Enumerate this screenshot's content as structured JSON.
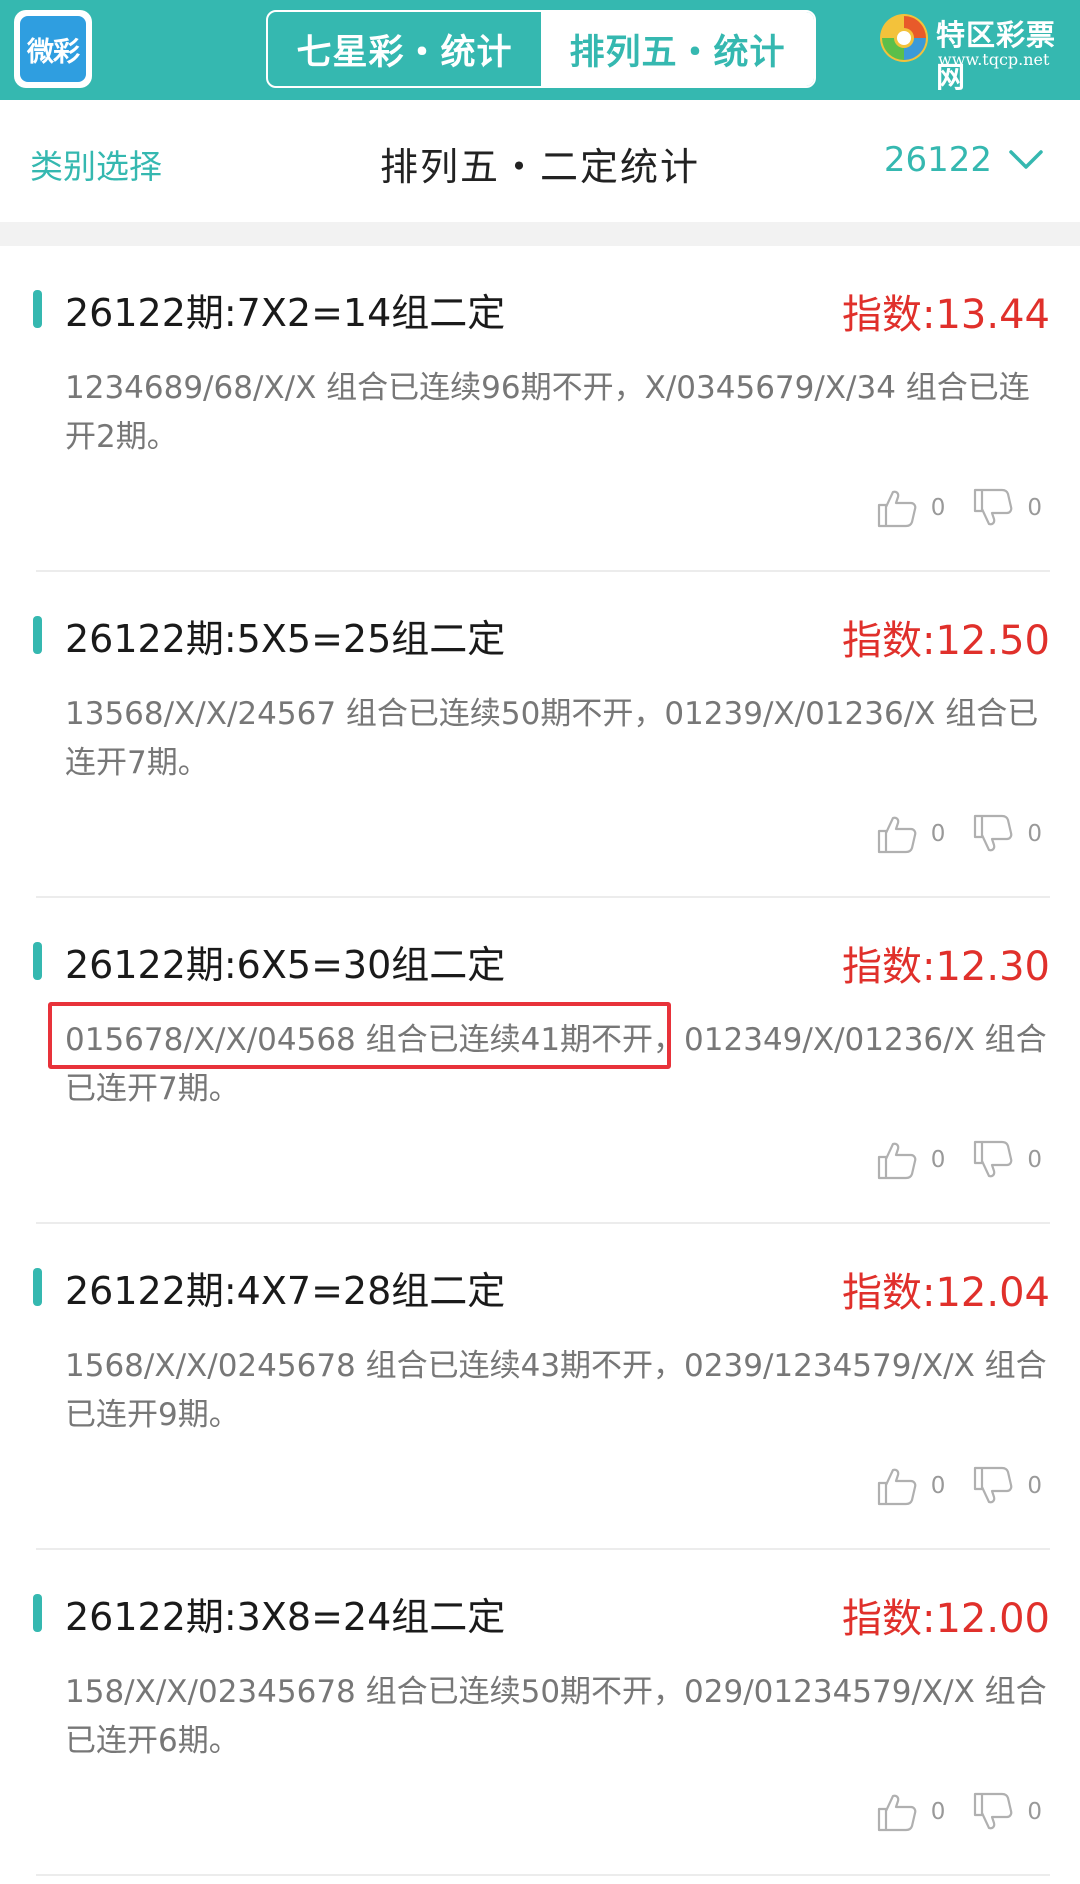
{
  "app": {
    "logo_text": "微彩"
  },
  "tabs": [
    {
      "label": "七星彩・统计",
      "active": false
    },
    {
      "label": "排列五・统计",
      "active": true
    }
  ],
  "brand": {
    "name": "特区彩票网",
    "url": "www.tqcp.net"
  },
  "header": {
    "category_label": "类别选择",
    "title": "排列五・二定统计",
    "period": "26122",
    "period_icon": "chevron-down-icon"
  },
  "colors": {
    "accent": "#35b8b0",
    "index_red": "#e0302b",
    "highlight": "#e8323a",
    "desc_gray": "#777777"
  },
  "cards": [
    {
      "title": "26122期:7X2=14组二定",
      "index": "指数:13.44",
      "desc": "1234689/68/X/X 组合已连续96期不开，X/0345679/X/34 组合已连开2期。",
      "likes": "0",
      "dislikes": "0"
    },
    {
      "title": "26122期:5X5=25组二定",
      "index": "指数:12.50",
      "desc": "13568/X/X/24567 组合已连续50期不开，01239/X/01236/X 组合已连开7期。",
      "likes": "0",
      "dislikes": "0"
    },
    {
      "title": "26122期:6X5=30组二定",
      "index": "指数:12.30",
      "desc": "015678/X/X/04568 组合已连续41期不开，012349/X/01236/X 组合已连开7期。",
      "likes": "0",
      "dislikes": "0"
    },
    {
      "title": "26122期:4X7=28组二定",
      "index": "指数:12.04",
      "desc": "1568/X/X/0245678 组合已连续43期不开，0239/1234579/X/X 组合已连开9期。",
      "likes": "0",
      "dislikes": "0"
    },
    {
      "title": "26122期:3X8=24组二定",
      "index": "指数:12.00",
      "desc": "158/X/X/02345678 组合已连续50期不开，029/01234579/X/X 组合已连开6期。",
      "likes": "0",
      "dislikes": "0"
    }
  ]
}
